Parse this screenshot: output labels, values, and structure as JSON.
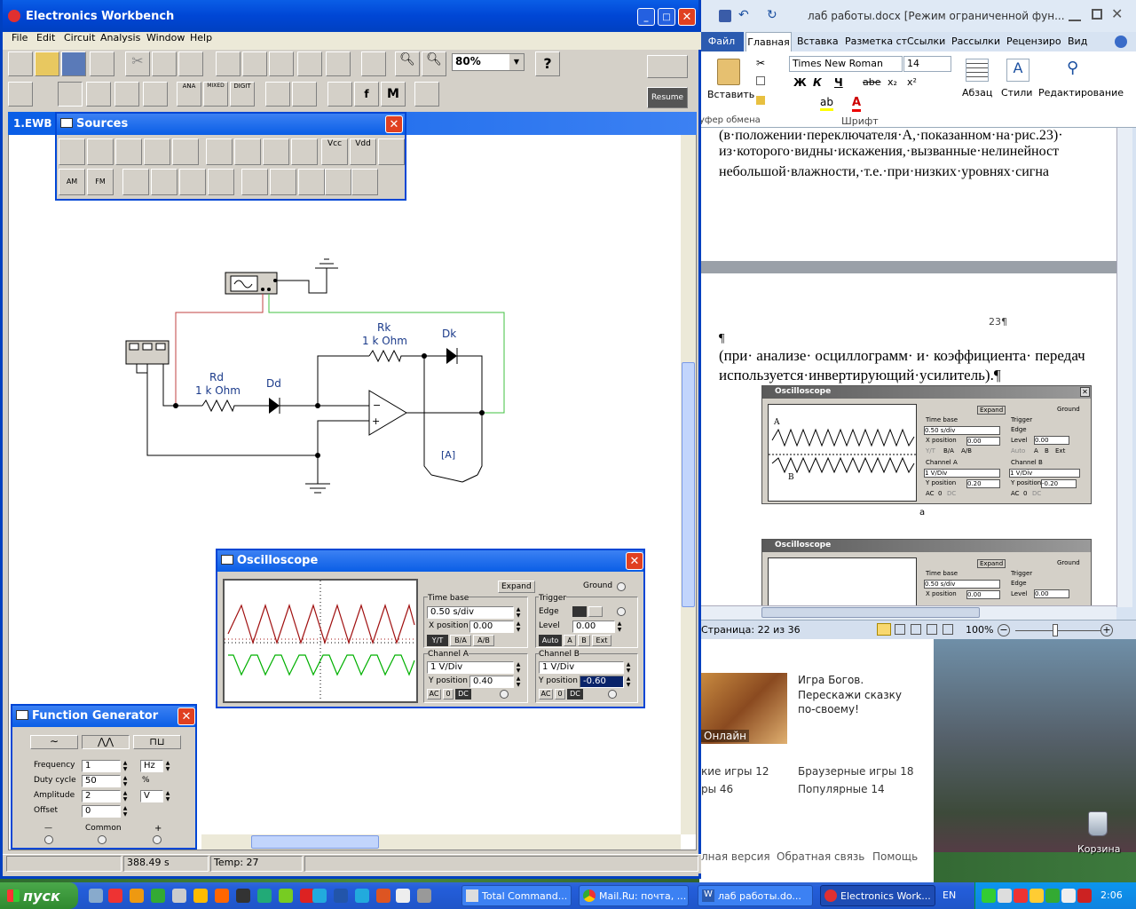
{
  "ewb": {
    "title": "Electronics Workbench",
    "menu": [
      "File",
      "Edit",
      "Circuit",
      "Analysis",
      "Window",
      "Help"
    ],
    "zoom": "80%",
    "help_glyph": "?",
    "status_time": "388.49 s",
    "status_temp": "Temp:  27",
    "doc_title": "1.EWB",
    "pause_label": "Resume",
    "misc_labels": {
      "ana": "ANA",
      "mixed": "MIXED",
      "digit": "DIGIT",
      "m": "M"
    }
  },
  "sources": {
    "title": "Sources",
    "labels": {
      "vcc": "Vcc",
      "vdd": "Vdd",
      "am": "AM",
      "fm": "FM"
    }
  },
  "circuit": {
    "rd_name": "Rd",
    "rd_value": "1 k Ohm",
    "dd_name": "Dd",
    "rk_name": "Rk",
    "rk_value": "1 k Ohm",
    "dk_name": "Dk",
    "switch_label": "[A]"
  },
  "oscilloscope": {
    "title": "Oscilloscope",
    "expand": "Expand",
    "ground": "Ground",
    "timebase_label": "Time base",
    "timebase_value": "0.50 s/div",
    "xpos_label": "X position",
    "xpos_value": "0.00",
    "mode_buttons": [
      "Y/T",
      "B/A",
      "A/B"
    ],
    "trigger_label": "Trigger",
    "edge_label": "Edge",
    "level_label": "Level",
    "level_value": "0.00",
    "trig_buttons": [
      "Auto",
      "A",
      "B",
      "Ext"
    ],
    "channel_a_label": "Channel A",
    "channel_a_value": "1  V/Div",
    "ypos_label": "Y position",
    "channel_a_ypos": "0.40",
    "channel_b_label": "Channel B",
    "channel_b_value": "1  V/Div",
    "channel_b_ypos": "-0.60",
    "coupling": [
      "AC",
      "0",
      "DC"
    ]
  },
  "function_generator": {
    "title": "Function Generator",
    "frequency_label": "Frequency",
    "frequency_value": "1",
    "frequency_unit": "Hz",
    "duty_label": "Duty cycle",
    "duty_value": "50",
    "duty_unit": "%",
    "amplitude_label": "Amplitude",
    "amplitude_value": "2",
    "amplitude_unit": "V",
    "offset_label": "Offset",
    "offset_value": "0",
    "minus": "—",
    "common": "Common",
    "plus": "+"
  },
  "word": {
    "title": "лаб работы.docx [Режим ограниченной фун...",
    "tabs": [
      "Файл",
      "Главная",
      "Вставка",
      "Разметка ст",
      "Ссылки",
      "Рассылки",
      "Рецензиро",
      "Вид"
    ],
    "paste": "Вставить",
    "clipboard": "уфер обмена",
    "font_name": "Times New Roman",
    "font_size": "14",
    "font_group": "Шрифт",
    "format_buttons": [
      "Ж",
      "К",
      "Ч",
      "abe",
      "x₂",
      "x²"
    ],
    "para": "Абзац",
    "styles": "Стили",
    "editing": "Редактирование",
    "line1": "(в·положении·переключателя·А,·показанном·на·рис.23)·",
    "line2": "из·которого·видны·искажения,·вызванные·нелинейност",
    "line3": "небольшой·влажности,·т.е.·при·низких·уровнях·сигна",
    "page_num": "23¶",
    "pilcrow": "¶",
    "line4": "(при· анализе· осциллограмм· и· коэффициента· передач",
    "line5": "используется·инвертирующий·усилитель).¶",
    "caption_a": "а",
    "status_page": "Страница: 22 из 36",
    "zoom": "100%"
  },
  "embedded_osc": {
    "title": "Oscilloscope",
    "expand": "Expand",
    "ground": "Ground",
    "time_base": "Time base",
    "tb_value": "0.50 s/div",
    "x_position": "X position",
    "xpos_value": "0.00",
    "trigger": "Trigger",
    "edge": "Edge",
    "level": "Level",
    "level_value": "0.00",
    "modes": [
      "Y/T",
      "B/A",
      "A/B"
    ],
    "trig_btns": [
      "Auto",
      "A",
      "B",
      "Ext"
    ],
    "channel_a": "Channel A",
    "channel_b": "Channel B",
    "vdiv": "1  V/Div",
    "y_position": "Y position",
    "ya": "0.20",
    "yb": "-0.20",
    "coupling": [
      "AC",
      "0",
      "DC"
    ],
    "trace_a": "A",
    "trace_b": "B"
  },
  "web": {
    "game_title": "Игра Богов.",
    "game_desc": "Перескажи сказку по-своему!",
    "online": "Онлайн",
    "links": [
      "кие игры 12",
      "ры 46",
      "Браузерные игры 18",
      "Популярные 14"
    ],
    "footer": [
      "лная версия",
      "Обратная связь",
      "Помощь"
    ]
  },
  "desktop": {
    "recycle": "Корзина"
  },
  "taskbar": {
    "start": "пуск",
    "tasks": [
      "Total Command...",
      "Mail.Ru: почта, ...",
      "лаб работы.do...",
      "Electronics Work..."
    ],
    "lang": "EN",
    "clock": "2:06"
  },
  "colors": {
    "trace_a": "#a01010",
    "trace_b": "#00b000",
    "xp_blue": "#0046d5"
  }
}
